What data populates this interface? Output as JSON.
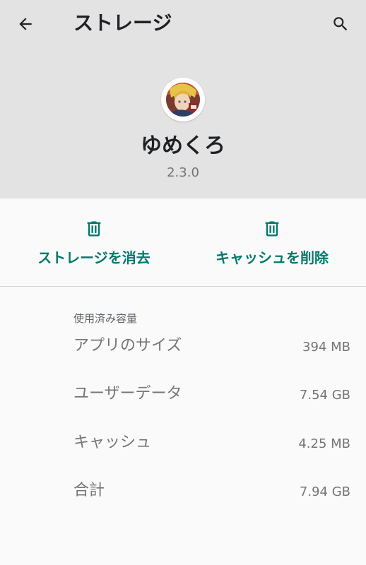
{
  "toolbar": {
    "title": "ストレージ",
    "back_icon": "arrow-back-icon",
    "search_icon": "search-icon"
  },
  "app": {
    "name": "ゆめくろ",
    "version": "2.3.0",
    "icon": "app-avatar-icon"
  },
  "actions": {
    "clear_storage": {
      "label": "ストレージを消去",
      "icon": "trash-icon"
    },
    "clear_cache": {
      "label": "キャッシュを削除",
      "icon": "trash-icon"
    }
  },
  "usage": {
    "title": "使用済み容量",
    "rows": [
      {
        "label": "アプリのサイズ",
        "value": "394 MB"
      },
      {
        "label": "ユーザーデータ",
        "value": "7.54 GB"
      },
      {
        "label": "キャッシュ",
        "value": "4.25 MB"
      },
      {
        "label": "合計",
        "value": "7.94 GB"
      }
    ]
  },
  "colors": {
    "header_bg": "#e3e3e3",
    "accent": "#00796b",
    "page_bg": "#fafafa"
  }
}
